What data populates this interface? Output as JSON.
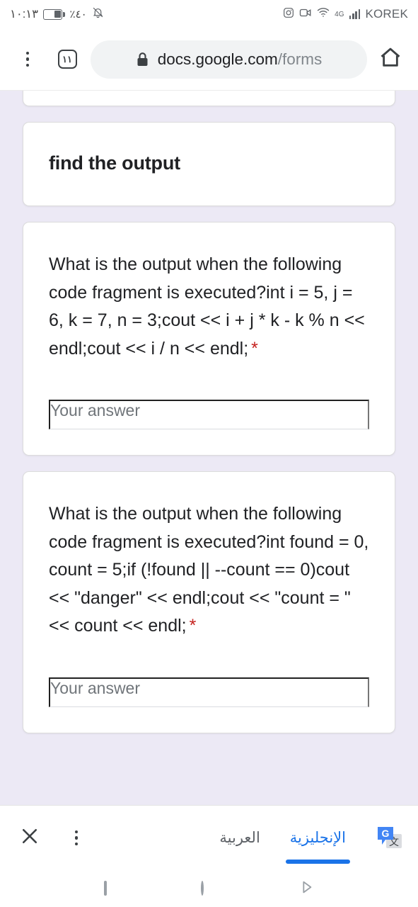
{
  "status_bar": {
    "time": "١٠:١٣",
    "battery_percent": "٪٤٠",
    "battery_level": 40,
    "icons": [
      "instagram-icon",
      "video-camera-icon",
      "wifi-icon",
      "mute-bell-icon"
    ],
    "network_generation": "4G",
    "carrier": "KOREK"
  },
  "browser": {
    "menu_label": "more-options",
    "tab_count": "١١",
    "url_domain": "docs.google.com",
    "url_path": "/forms",
    "security": "secure-lock",
    "home_label": "home"
  },
  "form": {
    "title": "find the output",
    "questions": [
      {
        "text": "What is the output when the following code fragment is executed?int i = 5, j = 6, k = 7, n = 3;cout << i + j * k - k % n << endl;cout << i / n << endl;",
        "required_marker": "*",
        "answer_placeholder": "Your answer",
        "answer_value": ""
      },
      {
        "text": "What is the output when the following code fragment is executed?int found = 0, count = 5;if (!found || --count == 0)cout << \"danger\" << endl;cout << \"count = \" << count << endl;",
        "required_marker": "*",
        "answer_placeholder": "Your answer",
        "answer_value": ""
      }
    ]
  },
  "translate_bar": {
    "close_label": "close",
    "menu_label": "translate-options",
    "languages": [
      {
        "label": "العربية",
        "active": false
      },
      {
        "label": "الإنجليزية",
        "active": true
      }
    ],
    "logo_label": "google-translate",
    "accent_color": "#1a73e8"
  },
  "android_nav": {
    "recents_label": "recents",
    "home_label": "home",
    "back_label": "back"
  },
  "colors": {
    "page_background": "#ece9f5",
    "card_background": "#ffffff",
    "required_red": "#c5221f",
    "accent_blue": "#1a73e8",
    "url_pill": "#f1f3f4"
  }
}
